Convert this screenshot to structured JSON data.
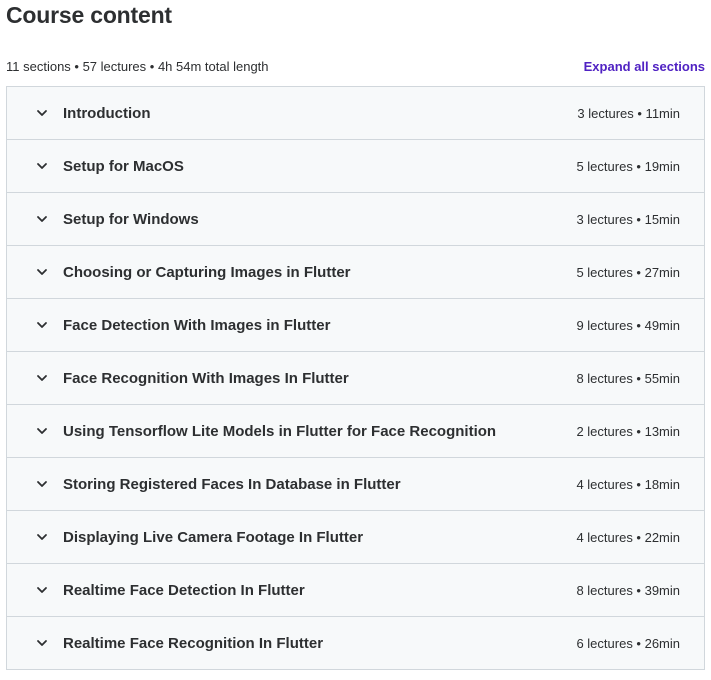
{
  "header": {
    "title": "Course content",
    "summary": "11 sections • 57 lectures • 4h 54m total length",
    "expand_label": "Expand all sections"
  },
  "icons": {
    "section_toggle": "chevron-down-icon"
  },
  "colors": {
    "accent": "#5022c3",
    "section_bg": "#f7f9fa",
    "border": "#d1d7dc",
    "text": "#2d2f31"
  },
  "sections": [
    {
      "title": "Introduction",
      "meta": "3 lectures • 11min"
    },
    {
      "title": "Setup for MacOS",
      "meta": "5 lectures • 19min"
    },
    {
      "title": "Setup for Windows",
      "meta": "3 lectures • 15min"
    },
    {
      "title": "Choosing or Capturing Images in Flutter",
      "meta": "5 lectures • 27min"
    },
    {
      "title": "Face Detection With Images in Flutter",
      "meta": "9 lectures • 49min"
    },
    {
      "title": "Face Recognition With Images In Flutter",
      "meta": "8 lectures • 55min"
    },
    {
      "title": "Using Tensorflow Lite Models in Flutter for Face Recognition",
      "meta": "2 lectures • 13min"
    },
    {
      "title": "Storing Registered Faces In Database in Flutter",
      "meta": "4 lectures • 18min"
    },
    {
      "title": "Displaying Live Camera Footage In Flutter",
      "meta": "4 lectures • 22min"
    },
    {
      "title": "Realtime Face Detection In Flutter",
      "meta": "8 lectures • 39min"
    },
    {
      "title": "Realtime Face Recognition In Flutter",
      "meta": "6 lectures • 26min"
    }
  ]
}
